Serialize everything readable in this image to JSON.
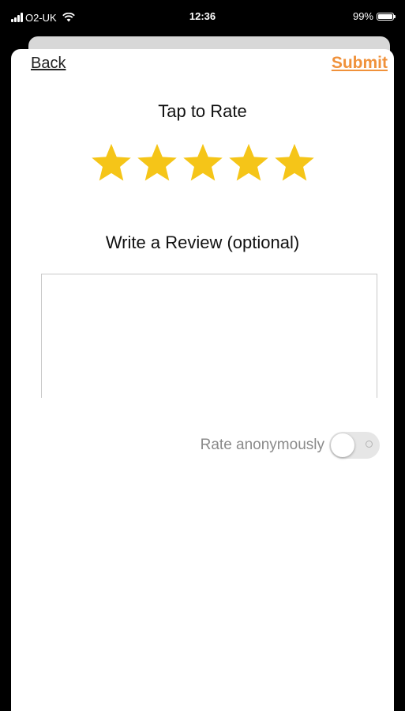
{
  "status_bar": {
    "carrier": "O2-UK",
    "time": "12:36",
    "battery_percent": "99%",
    "battery_level": 0.99,
    "signal_icon": "signal-bars-icon",
    "wifi_icon": "wifi-icon"
  },
  "nav": {
    "back_label": "Back",
    "submit_label": "Submit"
  },
  "rating": {
    "title": "Tap to Rate",
    "stars_total": 5,
    "stars_selected": 5,
    "star_color": "#f5c518"
  },
  "review": {
    "title": "Write a Review (optional)",
    "value": "",
    "placeholder": ""
  },
  "anonymous": {
    "label": "Rate anonymously",
    "enabled": false
  },
  "colors": {
    "accent": "#f0913a",
    "star": "#f5c518"
  }
}
